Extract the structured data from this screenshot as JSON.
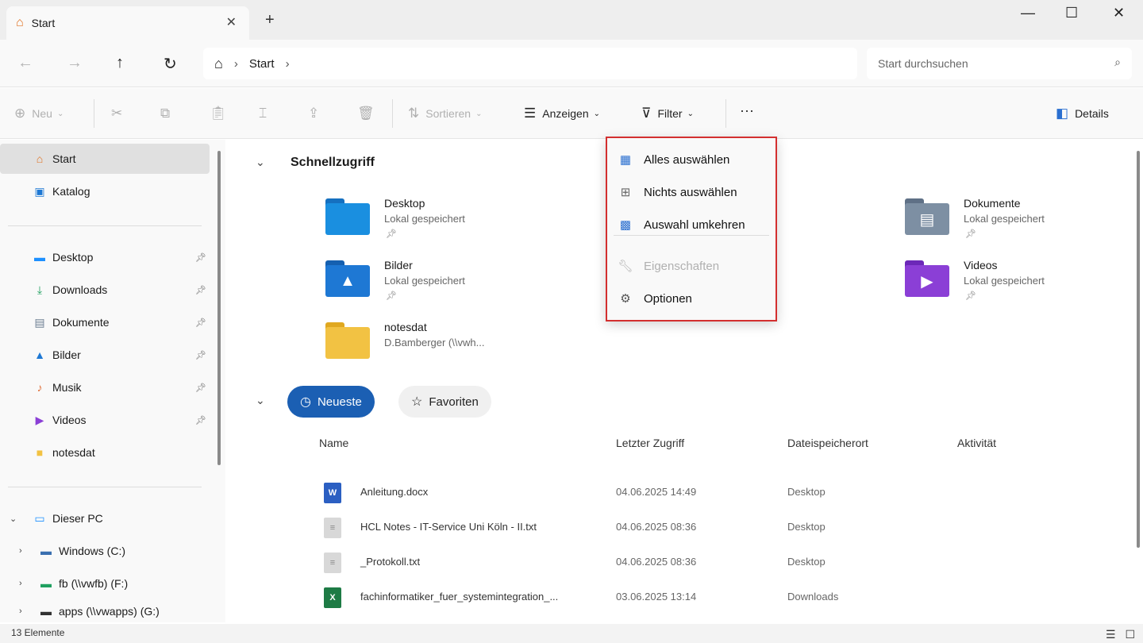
{
  "window": {
    "tab_label": "Start",
    "tab_close": "✕",
    "new_tab": "+",
    "minimize": "—",
    "maximize": "☐",
    "close": "✕"
  },
  "nav": {
    "back": "←",
    "forward": "→",
    "up": "↑",
    "refresh": "↻",
    "address_home": "⌂",
    "breadcrumb": [
      "Start"
    ],
    "sep": "›",
    "search_placeholder": "Start durchsuchen"
  },
  "toolbar": {
    "new_label": "Neu",
    "sort_label": "Sortieren",
    "view_label": "Anzeigen",
    "filter_label": "Filter",
    "more_label": "···",
    "details_label": "Details"
  },
  "sidebar": {
    "top_items": [
      {
        "label": "Start",
        "icon": "home-icon"
      },
      {
        "label": "Katalog",
        "icon": "gallery-icon"
      }
    ],
    "pinned_items": [
      {
        "label": "Desktop",
        "icon": "desktop-icon",
        "color": "#1e90ff"
      },
      {
        "label": "Downloads",
        "icon": "download-icon",
        "color": "#20a060"
      },
      {
        "label": "Dokumente",
        "icon": "document-icon",
        "color": "#6a7c90"
      },
      {
        "label": "Bilder",
        "icon": "pictures-icon",
        "color": "#1e78d4"
      },
      {
        "label": "Musik",
        "icon": "music-icon",
        "color": "#e0703a"
      },
      {
        "label": "Videos",
        "icon": "videos-icon",
        "color": "#8b3fd6"
      },
      {
        "label": "notesdat",
        "icon": "folder-icon",
        "color": "#f2c243"
      }
    ],
    "pc_label": "Dieser PC",
    "drives": [
      {
        "label": "Windows (C:)"
      },
      {
        "label": "fb (\\\\vwfb) (F:)"
      },
      {
        "label": "apps (\\\\vwapps) (G:)"
      }
    ]
  },
  "quick_access": {
    "title": "Schnellzugriff",
    "items": [
      {
        "name": "Desktop",
        "sub": "Lokal gespeichert",
        "pinned": true,
        "color": "#1a8fe0"
      },
      {
        "name": "Bilder",
        "sub": "Lokal gespeichert",
        "pinned": true,
        "color": "#1e78d4"
      },
      {
        "name": "notesdat",
        "sub": "D.Bamberger (\\\\vwh...",
        "pinned": false,
        "color": "#f2c243"
      },
      {
        "name": "Dokumente",
        "sub": "Lokal gespeichert",
        "pinned": true,
        "color": "#7d8fa3"
      },
      {
        "name": "Videos",
        "sub": "Lokal gespeichert",
        "pinned": true,
        "color": "#8b3fd6"
      }
    ]
  },
  "recent": {
    "tab_recent": "Neueste",
    "tab_favorites": "Favoriten",
    "columns": [
      "Name",
      "Letzter Zugriff",
      "Dateispeicherort",
      "Aktivität"
    ],
    "rows": [
      {
        "name": "Anleitung.docx",
        "date": "04.06.2025 14:49",
        "location": "Desktop",
        "type": "word"
      },
      {
        "name": "HCL Notes - IT-Service Uni Köln - II.txt",
        "date": "04.06.2025 08:36",
        "location": "Desktop",
        "type": "txt"
      },
      {
        "name": "_Protokoll.txt",
        "date": "04.06.2025 08:36",
        "location": "Desktop",
        "type": "txt"
      },
      {
        "name": "fachinformatiker_fuer_systemintegration_...",
        "date": "03.06.2025 13:14",
        "location": "Downloads",
        "type": "excel"
      }
    ]
  },
  "context_menu": {
    "select_all": "Alles auswählen",
    "select_none": "Nichts auswählen",
    "invert": "Auswahl umkehren",
    "properties": "Eigenschaften",
    "options": "Optionen"
  },
  "status": {
    "count": "13 Elemente"
  },
  "colors": {
    "accent": "#1b5fb3",
    "highlight_border": "#d32f2f"
  }
}
